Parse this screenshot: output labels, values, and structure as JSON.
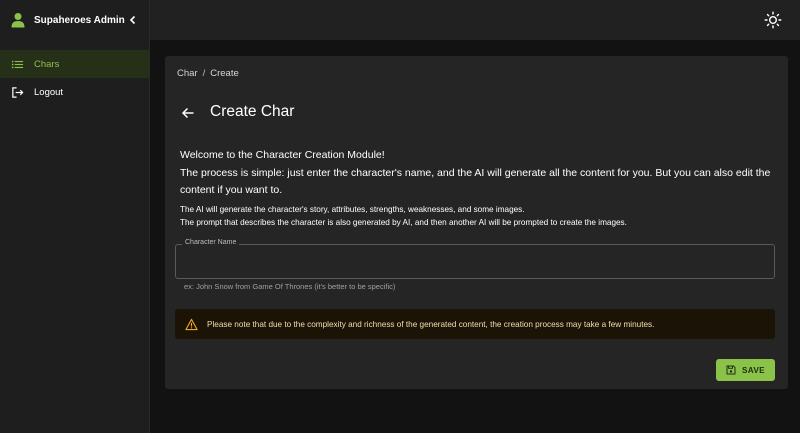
{
  "app": {
    "title": "Supaheroes Admin"
  },
  "sidebar": {
    "items": [
      {
        "label": "Chars",
        "icon": "list-icon",
        "active": true
      },
      {
        "label": "Logout",
        "icon": "logout-icon",
        "active": false
      }
    ]
  },
  "topbar": {
    "theme_icon": "sun-icon"
  },
  "breadcrumb": {
    "items": [
      "Char",
      "Create"
    ],
    "separator": "/"
  },
  "page": {
    "title": "Create Char"
  },
  "intro": {
    "heading": "Welcome to the Character Creation Module!",
    "description": "The process is simple: just enter the character's name, and the AI will generate all the content for you. But you can also edit the content if you want to.",
    "detail1": "The AI will generate the character's story, attributes, strengths, weaknesses, and some images.",
    "detail2": "The prompt that describes the character is also generated by AI, and then another AI will be prompted to create the images."
  },
  "form": {
    "name_label": "Character Name",
    "name_value": "",
    "helper": "ex: John Snow from Game Of Thrones (it's better to be specific)"
  },
  "alert": {
    "message": "Please note that due to the complexity and richness of the generated content, the creation process may take a few minutes.",
    "icon": "warning-icon"
  },
  "actions": {
    "save_label": "SAVE"
  },
  "colors": {
    "accent": "#8bc34a",
    "background": "#121212",
    "card": "#252525",
    "warning_bg": "#1b1406",
    "warning_text": "#f5deb0"
  }
}
